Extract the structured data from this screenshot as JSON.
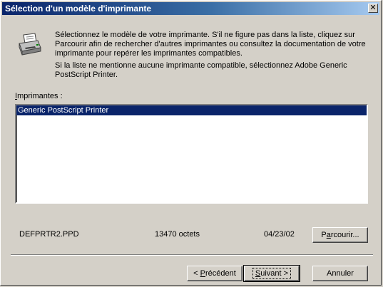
{
  "window": {
    "title": "Sélection d'un modèle d'imprimante",
    "close_glyph": "✕"
  },
  "description": {
    "paragraph1": "Sélectionnez le modèle de votre imprimante. S'il ne figure pas dans la liste, cliquez sur Parcourir afin de rechercher d'autres imprimantes ou consultez la documentation de votre imprimante pour repérer les imprimantes compatibles.",
    "paragraph2": "Si la liste ne mentionne aucune imprimante compatible, sélectionnez Adobe Generic PostScript Printer."
  },
  "printer_list": {
    "label_first": "I",
    "label_rest": "mprimantes :",
    "items": [
      {
        "label": "Generic PostScript Printer",
        "selected": true
      }
    ]
  },
  "file_info": {
    "filename": "DEFPRTR2.PPD",
    "size": "13470 octets",
    "date": "04/23/02"
  },
  "buttons": {
    "browse_pre": "P",
    "browse_ul": "a",
    "browse_post": "rcourir...",
    "back_pre": "< ",
    "back_ul": "P",
    "back_post": "récédent",
    "next_ul": "S",
    "next_post": "uivant >",
    "cancel": "Annuler"
  },
  "icons": {
    "printer": "printer-icon",
    "close": "close-icon"
  }
}
